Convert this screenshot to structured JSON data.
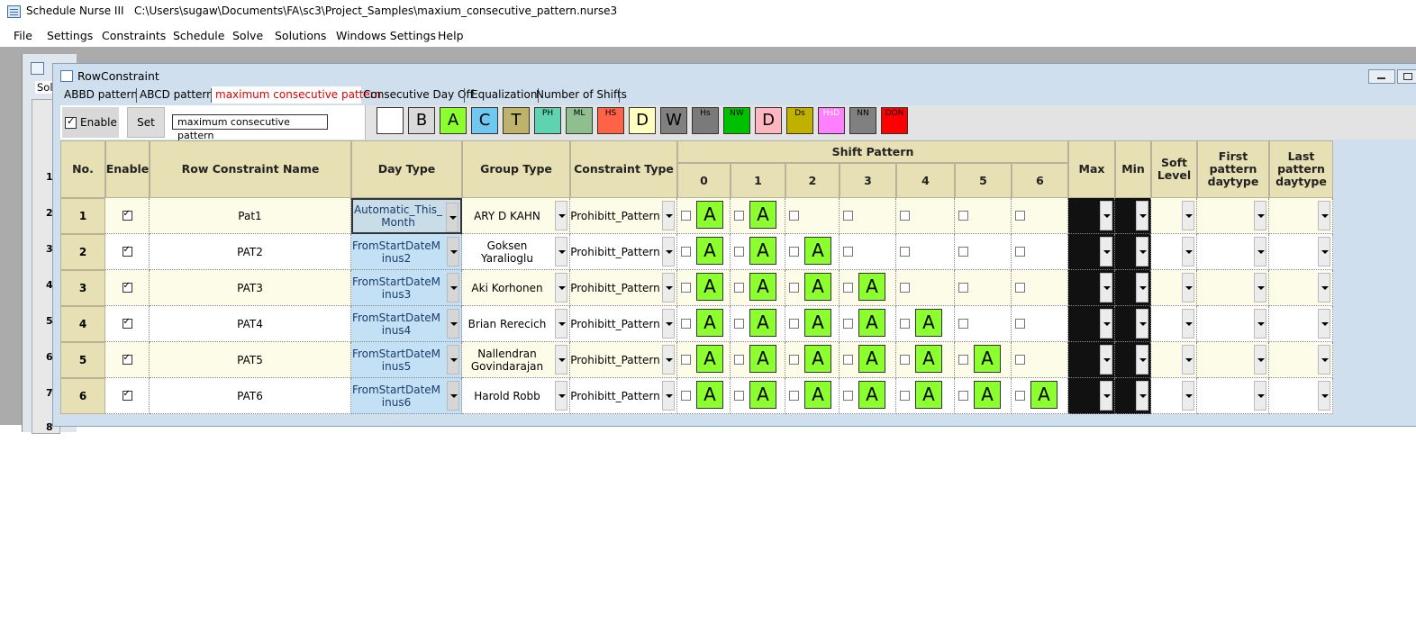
{
  "app": {
    "title": "Schedule Nurse III",
    "path": "C:\\Users\\sugaw\\Documents\\FA\\sc3\\Project_Samples\\maxium_consecutive_pattern.nurse3"
  },
  "menu": [
    "File",
    "Settings",
    "Constraints",
    "Schedule",
    "Solve",
    "Solutions",
    "Windows Settings",
    "Help"
  ],
  "bg_window": {
    "label": "Sol",
    "row_numbers": [
      "1",
      "2",
      "3",
      "4",
      "5",
      "6",
      "7",
      "8"
    ]
  },
  "window": {
    "title": "RowConstraint"
  },
  "tabs": [
    {
      "label": "ABBD pattern",
      "active": false
    },
    {
      "label": "ABCD pattern",
      "active": false
    },
    {
      "label": "maximum consecutive pattern",
      "active": true
    },
    {
      "label": "Consecutive Day Off",
      "active": false
    },
    {
      "label": "Equalization",
      "active": false
    },
    {
      "label": "Number of Shifts",
      "active": false
    }
  ],
  "toolbar": {
    "enable_label": "Enable",
    "set_label": "Set",
    "name_value": "maximum consecutive pattern"
  },
  "palette": [
    {
      "label": "",
      "color": "#ffffff"
    },
    {
      "label": "B",
      "color": "#d9d9d9"
    },
    {
      "label": "A",
      "color": "#8cff2e"
    },
    {
      "label": "C",
      "color": "#6ec8f0"
    },
    {
      "label": "T",
      "color": "#bfb26a"
    },
    {
      "label": "PH",
      "color": "#5fd3b0"
    },
    {
      "label": "ML",
      "color": "#8fbf8f"
    },
    {
      "label": "HS",
      "color": "#ff6347"
    },
    {
      "label": "D",
      "color": "#ffffc0"
    },
    {
      "label": "W",
      "color": "#808080"
    },
    {
      "label": "Hs",
      "color": "#7a7a7a"
    },
    {
      "label": "NW",
      "color": "#00c000"
    },
    {
      "label": "D",
      "color": "#ffb6c1"
    },
    {
      "label": "Ds",
      "color": "#c0b000"
    },
    {
      "label": "HsD",
      "color": "#ff80ff"
    },
    {
      "label": "NN",
      "color": "#808080"
    },
    {
      "label": "DON",
      "color": "#ff0000"
    }
  ],
  "headers": {
    "no": "No.",
    "enable": "Enable",
    "name": "Row Constraint Name",
    "day_type": "Day Type",
    "group_type": "Group Type",
    "constraint_type": "Constraint Type",
    "shift_pattern": "Shift Pattern",
    "shift_cols": [
      "0",
      "1",
      "2",
      "3",
      "4",
      "5",
      "6"
    ],
    "max": "Max",
    "min": "Min",
    "soft_level": "Soft Level",
    "first_pattern": "First pattern daytype",
    "last_pattern": "Last pattern daytype"
  },
  "rows": [
    {
      "no": "1",
      "name": "Pat1",
      "day_type": "Automatic_This_Month",
      "group": "ARY D KAHN",
      "constraint": "Prohibitt_Pattern",
      "shifts": [
        "A",
        "A",
        "",
        "",
        "",
        "",
        ""
      ]
    },
    {
      "no": "2",
      "name": "PAT2",
      "day_type": "FromStartDateMinus2",
      "group": "Goksen Yaralioglu",
      "constraint": "Prohibitt_Pattern",
      "shifts": [
        "A",
        "A",
        "A",
        "",
        "",
        "",
        ""
      ]
    },
    {
      "no": "3",
      "name": "PAT3",
      "day_type": "FromStartDateMinus3",
      "group": "Aki Korhonen",
      "constraint": "Prohibitt_Pattern",
      "shifts": [
        "A",
        "A",
        "A",
        "A",
        "",
        "",
        ""
      ]
    },
    {
      "no": "4",
      "name": "PAT4",
      "day_type": "FromStartDateMinus4",
      "group": "Brian Rerecich",
      "constraint": "Prohibitt_Pattern",
      "shifts": [
        "A",
        "A",
        "A",
        "A",
        "A",
        "",
        ""
      ]
    },
    {
      "no": "5",
      "name": "PAT5",
      "day_type": "FromStartDateMinus5",
      "group": "Nallendran Govindarajan",
      "constraint": "Prohibitt_Pattern",
      "shifts": [
        "A",
        "A",
        "A",
        "A",
        "A",
        "A",
        ""
      ]
    },
    {
      "no": "6",
      "name": "PAT6",
      "day_type": "FromStartDateMinus6",
      "group": "Harold Robb",
      "constraint": "Prohibitt_Pattern",
      "shifts": [
        "A",
        "A",
        "A",
        "A",
        "A",
        "A",
        "A"
      ]
    }
  ]
}
